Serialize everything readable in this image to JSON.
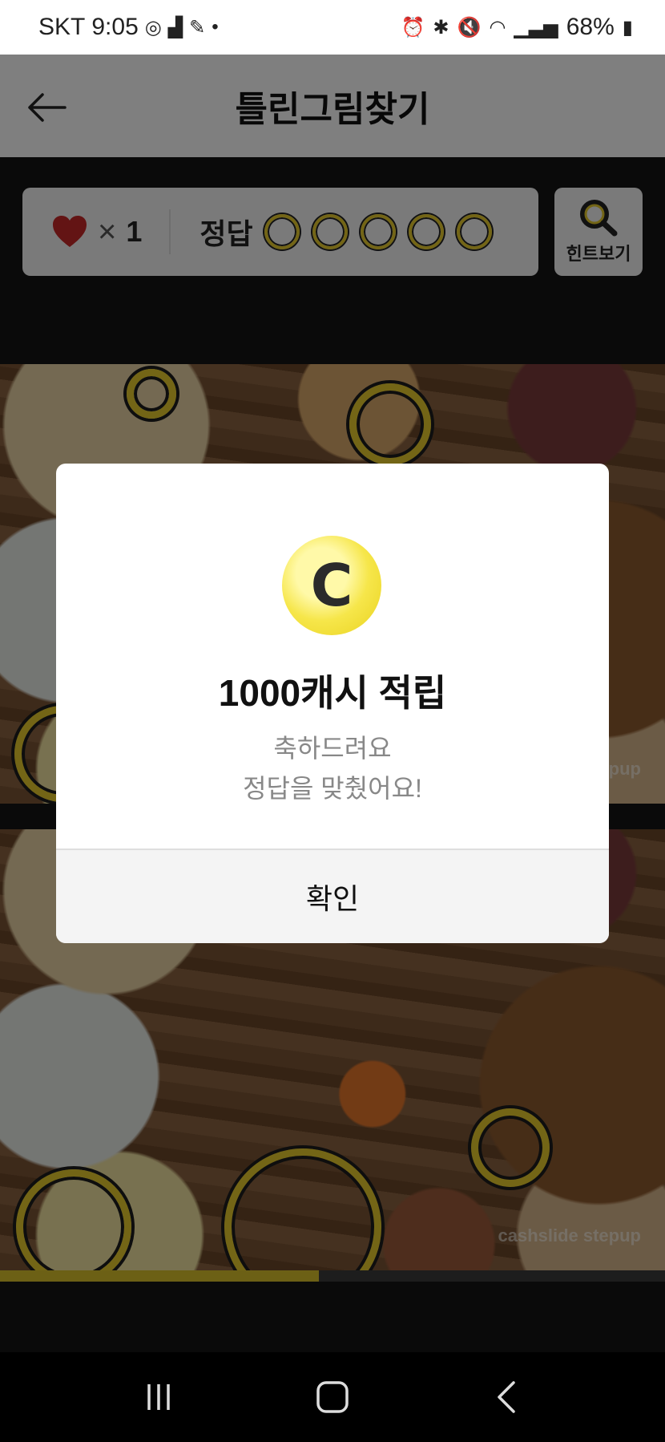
{
  "status_bar": {
    "carrier": "SKT",
    "time": "9:05",
    "battery": "68%"
  },
  "header": {
    "title": "틀린그림찾기",
    "back_icon": "arrow-left-icon"
  },
  "game": {
    "lives_icon": "heart-icon",
    "times": "×",
    "lives": "1",
    "answer_label": "정답",
    "answer_slots_total": 5,
    "hint_label": "힌트보기",
    "hint_icon": "magnifier-icon",
    "watermark": "cashslide stepup",
    "accent_color": "#e6cb2c",
    "progress_fraction": 0.48
  },
  "modal": {
    "coin_letter": "C",
    "title": "1000캐시 적립",
    "message_line1": "축하드려요",
    "message_line2": "정답을 맞췄어요!",
    "confirm_label": "확인"
  },
  "nav": {
    "recents_icon": "recents-icon",
    "home_icon": "home-icon",
    "back_icon": "back-icon"
  }
}
